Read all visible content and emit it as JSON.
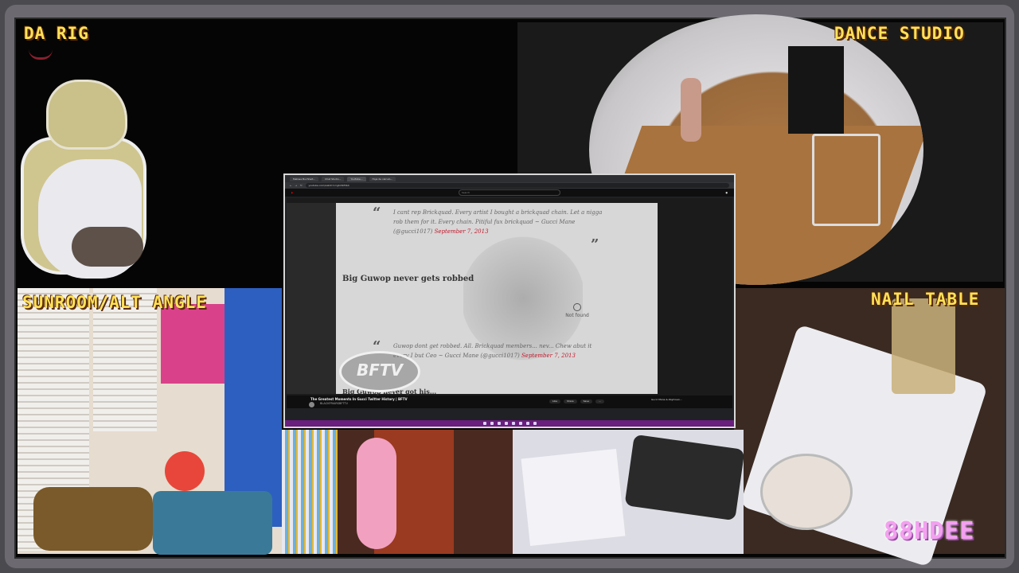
{
  "labels": {
    "da_rig": "DA RIG",
    "dance_studio": "DANCE STUDIO",
    "sunroom": "SUNROOM/ALT ANGLE",
    "nail_table": "NAIL TABLE",
    "watermark": "88HDEE"
  },
  "browser": {
    "tabs": [
      "Melissa Buchheit...",
      "Chat Studio...",
      "YouTube...",
      "Hoja de calculo..."
    ],
    "url": "youtube.com/watch?v=gtv5Kf3b4",
    "search_placeholder": "Search",
    "video": {
      "quote1": "I cant rep Brickquad. Every artist I bought a brickquad chain. Let a nigga rob them for it. Every chain. Pitiful fux brickquad ~ Gucci Mane (@gucci1017)",
      "quote1_date": "September 7, 2013",
      "heading1": "Big Guwop never gets robbed",
      "not_found": "Not found",
      "quote2": "Guwop dont get robbed. All. Brickquad members... nev... Chew abut it every I but Ceo ~ Gucci Mane (@gucci1017)",
      "quote2_date": "September 7, 2013",
      "heading2": "Big Guwop never got his...",
      "logo": "BFTV"
    },
    "meta": {
      "title": "The Greatest Moments In Gucci Twitter History | BFTV",
      "channel": "BLACKFRIARSBFTTV",
      "buttons": [
        "Like",
        "Share",
        "Save",
        "..."
      ],
      "sidebar_item": "Gucci Mane & Zaytoven..."
    }
  }
}
